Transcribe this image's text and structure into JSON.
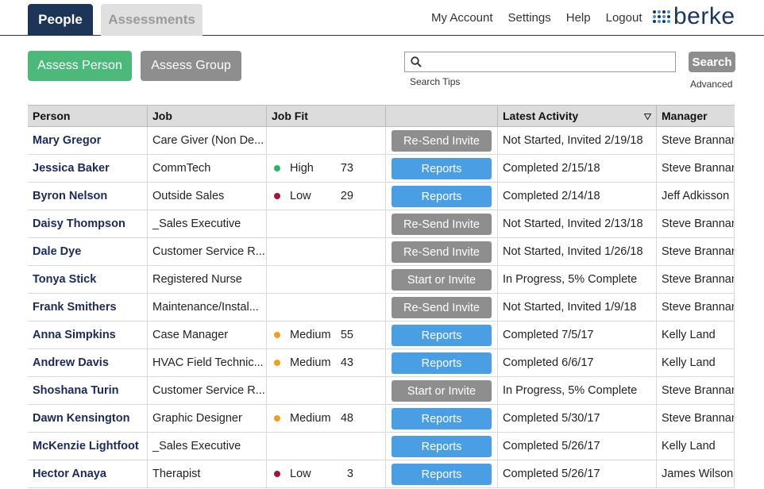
{
  "tabs": {
    "people": "People",
    "assessments": "Assessments"
  },
  "nav": [
    "My Account",
    "Settings",
    "Help",
    "Logout"
  ],
  "brand": {
    "name": "berke",
    "dot_colors": [
      "#1d3557",
      "#4a90d9",
      "#1d3557",
      "#4a90d9",
      "#4a90d9",
      "#1d3557",
      "#4a90d9",
      "#1d3557",
      "#1d3557",
      "#4a90d9",
      "#1d3557",
      "#4a90d9"
    ]
  },
  "actions": {
    "assess_person": "Assess Person",
    "assess_group": "Assess Group"
  },
  "search": {
    "value": "",
    "placeholder": "",
    "tips": "Search Tips",
    "button": "Search",
    "advanced": "Advanced"
  },
  "colors": {
    "people_tab": "#1d3557",
    "assess_person": "#4cb97a",
    "gray_button": "#8e8e8e",
    "reports_button": "#4a9ee3",
    "fit_high": "#2cb46b",
    "fit_medium": "#f0a020",
    "fit_low": "#a3133a"
  },
  "table": {
    "headers": {
      "person": "Person",
      "job": "Job",
      "fit": "Job Fit",
      "action": "",
      "latest": "Latest Activity",
      "manager": "Manager"
    },
    "sort_icon": "triangle-down-icon",
    "rows": [
      {
        "person": "Mary Gregor",
        "job": "Care Giver (Non De...",
        "fit": null,
        "action": "Re-Send Invite",
        "action_type": "gray",
        "latest": "Not Started, Invited 2/19/18",
        "manager": "Steve Brannan"
      },
      {
        "person": "Jessica Baker",
        "job": "CommTech",
        "fit": {
          "level": "High",
          "score": "73",
          "color": "#2cb46b"
        },
        "action": "Reports",
        "action_type": "blue",
        "latest": "Completed 2/15/18",
        "manager": "Steve Brannan"
      },
      {
        "person": "Byron Nelson",
        "job": "Outside Sales",
        "fit": {
          "level": "Low",
          "score": "29",
          "color": "#a3133a"
        },
        "action": "Reports",
        "action_type": "blue",
        "latest": "Completed 2/14/18",
        "manager": "Jeff Adkisson"
      },
      {
        "person": "Daisy Thompson",
        "job": "_Sales Executive",
        "fit": null,
        "action": "Re-Send Invite",
        "action_type": "gray",
        "latest": "Not Started, Invited 2/13/18",
        "manager": "Steve Brannan"
      },
      {
        "person": "Dale Dye",
        "job": "Customer Service R...",
        "fit": null,
        "action": "Re-Send Invite",
        "action_type": "gray",
        "latest": "Not Started, Invited 1/26/18",
        "manager": "Steve Brannan"
      },
      {
        "person": "Tonya Stick",
        "job": "Registered Nurse",
        "fit": null,
        "action": "Start or Invite",
        "action_type": "gray",
        "latest": "In Progress, 5% Complete",
        "manager": "Steve Brannan"
      },
      {
        "person": "Frank Smithers",
        "job": "Maintenance/Instal...",
        "fit": null,
        "action": "Re-Send Invite",
        "action_type": "gray",
        "latest": "Not Started, Invited 1/9/18",
        "manager": "Steve Brannan"
      },
      {
        "person": "Anna Simpkins",
        "job": "Case Manager",
        "fit": {
          "level": "Medium",
          "score": "55",
          "color": "#f0a020"
        },
        "action": "Reports",
        "action_type": "blue",
        "latest": "Completed 7/5/17",
        "manager": "Kelly Land"
      },
      {
        "person": "Andrew Davis",
        "job": "HVAC Field Technic...",
        "fit": {
          "level": "Medium",
          "score": "43",
          "color": "#f0a020"
        },
        "action": "Reports",
        "action_type": "blue",
        "latest": "Completed 6/6/17",
        "manager": "Kelly Land"
      },
      {
        "person": "Shoshana Turin",
        "job": "Customer Service R...",
        "fit": null,
        "action": "Start or Invite",
        "action_type": "gray",
        "latest": "In Progress, 5% Complete",
        "manager": "Steve Brannan"
      },
      {
        "person": "Dawn Kensington",
        "job": "Graphic Designer",
        "fit": {
          "level": "Medium",
          "score": "48",
          "color": "#f0a020"
        },
        "action": "Reports",
        "action_type": "blue",
        "latest": "Completed 5/30/17",
        "manager": "Steve Brannan"
      },
      {
        "person": "McKenzie Lightfoot",
        "job": "_Sales Executive",
        "fit": null,
        "action": "Reports",
        "action_type": "blue",
        "latest": "Completed 5/26/17",
        "manager": "Kelly Land"
      },
      {
        "person": "Hector Anaya",
        "job": "Therapist",
        "fit": {
          "level": "Low",
          "score": "3",
          "color": "#a3133a"
        },
        "action": "Reports",
        "action_type": "blue",
        "latest": "Completed 5/26/17",
        "manager": "James Wilson"
      }
    ]
  }
}
